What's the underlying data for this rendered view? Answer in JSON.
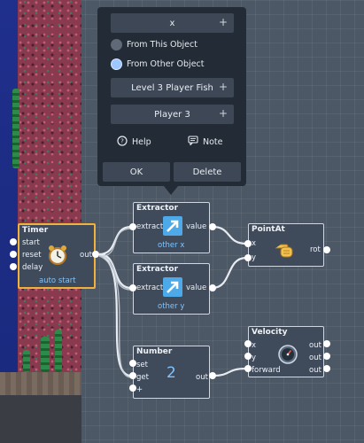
{
  "popup": {
    "field_label": "x",
    "radio_this": "From This Object",
    "radio_other": "From Other Object",
    "target_object": "Level 3 Player Fish",
    "player": "Player 3",
    "help_label": "Help",
    "note_label": "Note",
    "ok_label": "OK",
    "delete_label": "Delete",
    "plus": "+"
  },
  "nodes": {
    "timer": {
      "title": "Timer",
      "inputs": [
        "start",
        "reset",
        "delay"
      ],
      "output": "out",
      "footer": "auto start"
    },
    "extractor_x": {
      "title": "Extractor",
      "input": "extract",
      "output": "value",
      "footer": "other x"
    },
    "extractor_y": {
      "title": "Extractor",
      "input": "extract",
      "output": "value",
      "footer": "other y"
    },
    "pointat": {
      "title": "PointAt",
      "inputs": [
        "x",
        "y"
      ],
      "output": "rot"
    },
    "number": {
      "title": "Number",
      "inputs": [
        "set",
        "get",
        "+"
      ],
      "value": "2",
      "output": "out"
    },
    "velocity": {
      "title": "Velocity",
      "inputs": [
        "x",
        "y",
        "forward"
      ],
      "outputs": [
        "out",
        "out",
        "out"
      ]
    }
  },
  "colors": {
    "accent": "#7fc4ff",
    "selected_border": "#f0b23a",
    "node_bg": "#3f4a5a",
    "popup_bg": "#232b36"
  }
}
